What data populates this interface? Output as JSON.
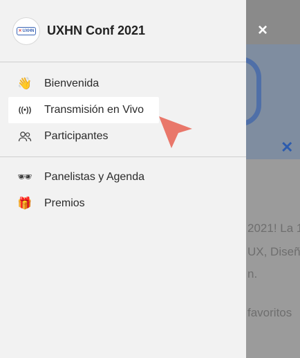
{
  "app": {
    "title": "UXHN Conf 2021",
    "avatar_text": "UXHN"
  },
  "nav": {
    "group1": [
      {
        "icon": "waving-hand-icon",
        "glyph": "👋",
        "label": "Bienvenida"
      },
      {
        "icon": "broadcast-icon",
        "glyph": "((•))",
        "label": "Transmisión en Vivo",
        "active": true
      },
      {
        "icon": "people-icon",
        "glyph": "👥",
        "label": "Participantes"
      }
    ],
    "group2": [
      {
        "icon": "sunglasses-icon",
        "glyph": "🕶",
        "label": "Panelistas y Agenda"
      },
      {
        "icon": "gift-icon",
        "glyph": "🎁",
        "label": "Premios"
      }
    ]
  },
  "close_glyph": "×",
  "background_text": {
    "line1": "2021! La 1",
    "line2": "UX, Diseñ",
    "line3": "n.",
    "line4": "favoritos"
  },
  "colors": {
    "drawer_bg": "#f2f2f2",
    "active_bg": "#ffffff",
    "accent_blue": "#3a64b5",
    "pointer": "#e9776a"
  }
}
